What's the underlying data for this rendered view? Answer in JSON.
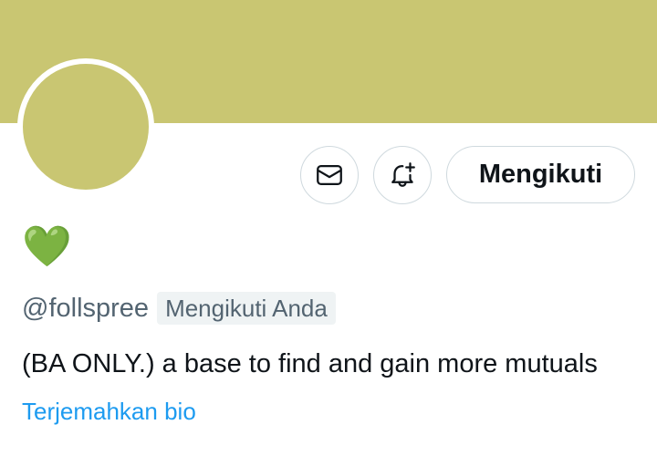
{
  "profile": {
    "display_name": "💚",
    "handle": "@follspree",
    "follows_you_badge": "Mengikuti Anda",
    "bio": "(BA ONLY.) a base to find and gain more mutuals",
    "translate_link": "Terjemahkan bio"
  },
  "actions": {
    "follow_label": "Mengikuti",
    "message_icon": "mail-icon",
    "notify_icon": "bell-plus-icon"
  },
  "colors": {
    "banner": "#c9c672",
    "avatar": "#c9c672",
    "link": "#1d9bf0",
    "secondary_text": "#536471"
  }
}
